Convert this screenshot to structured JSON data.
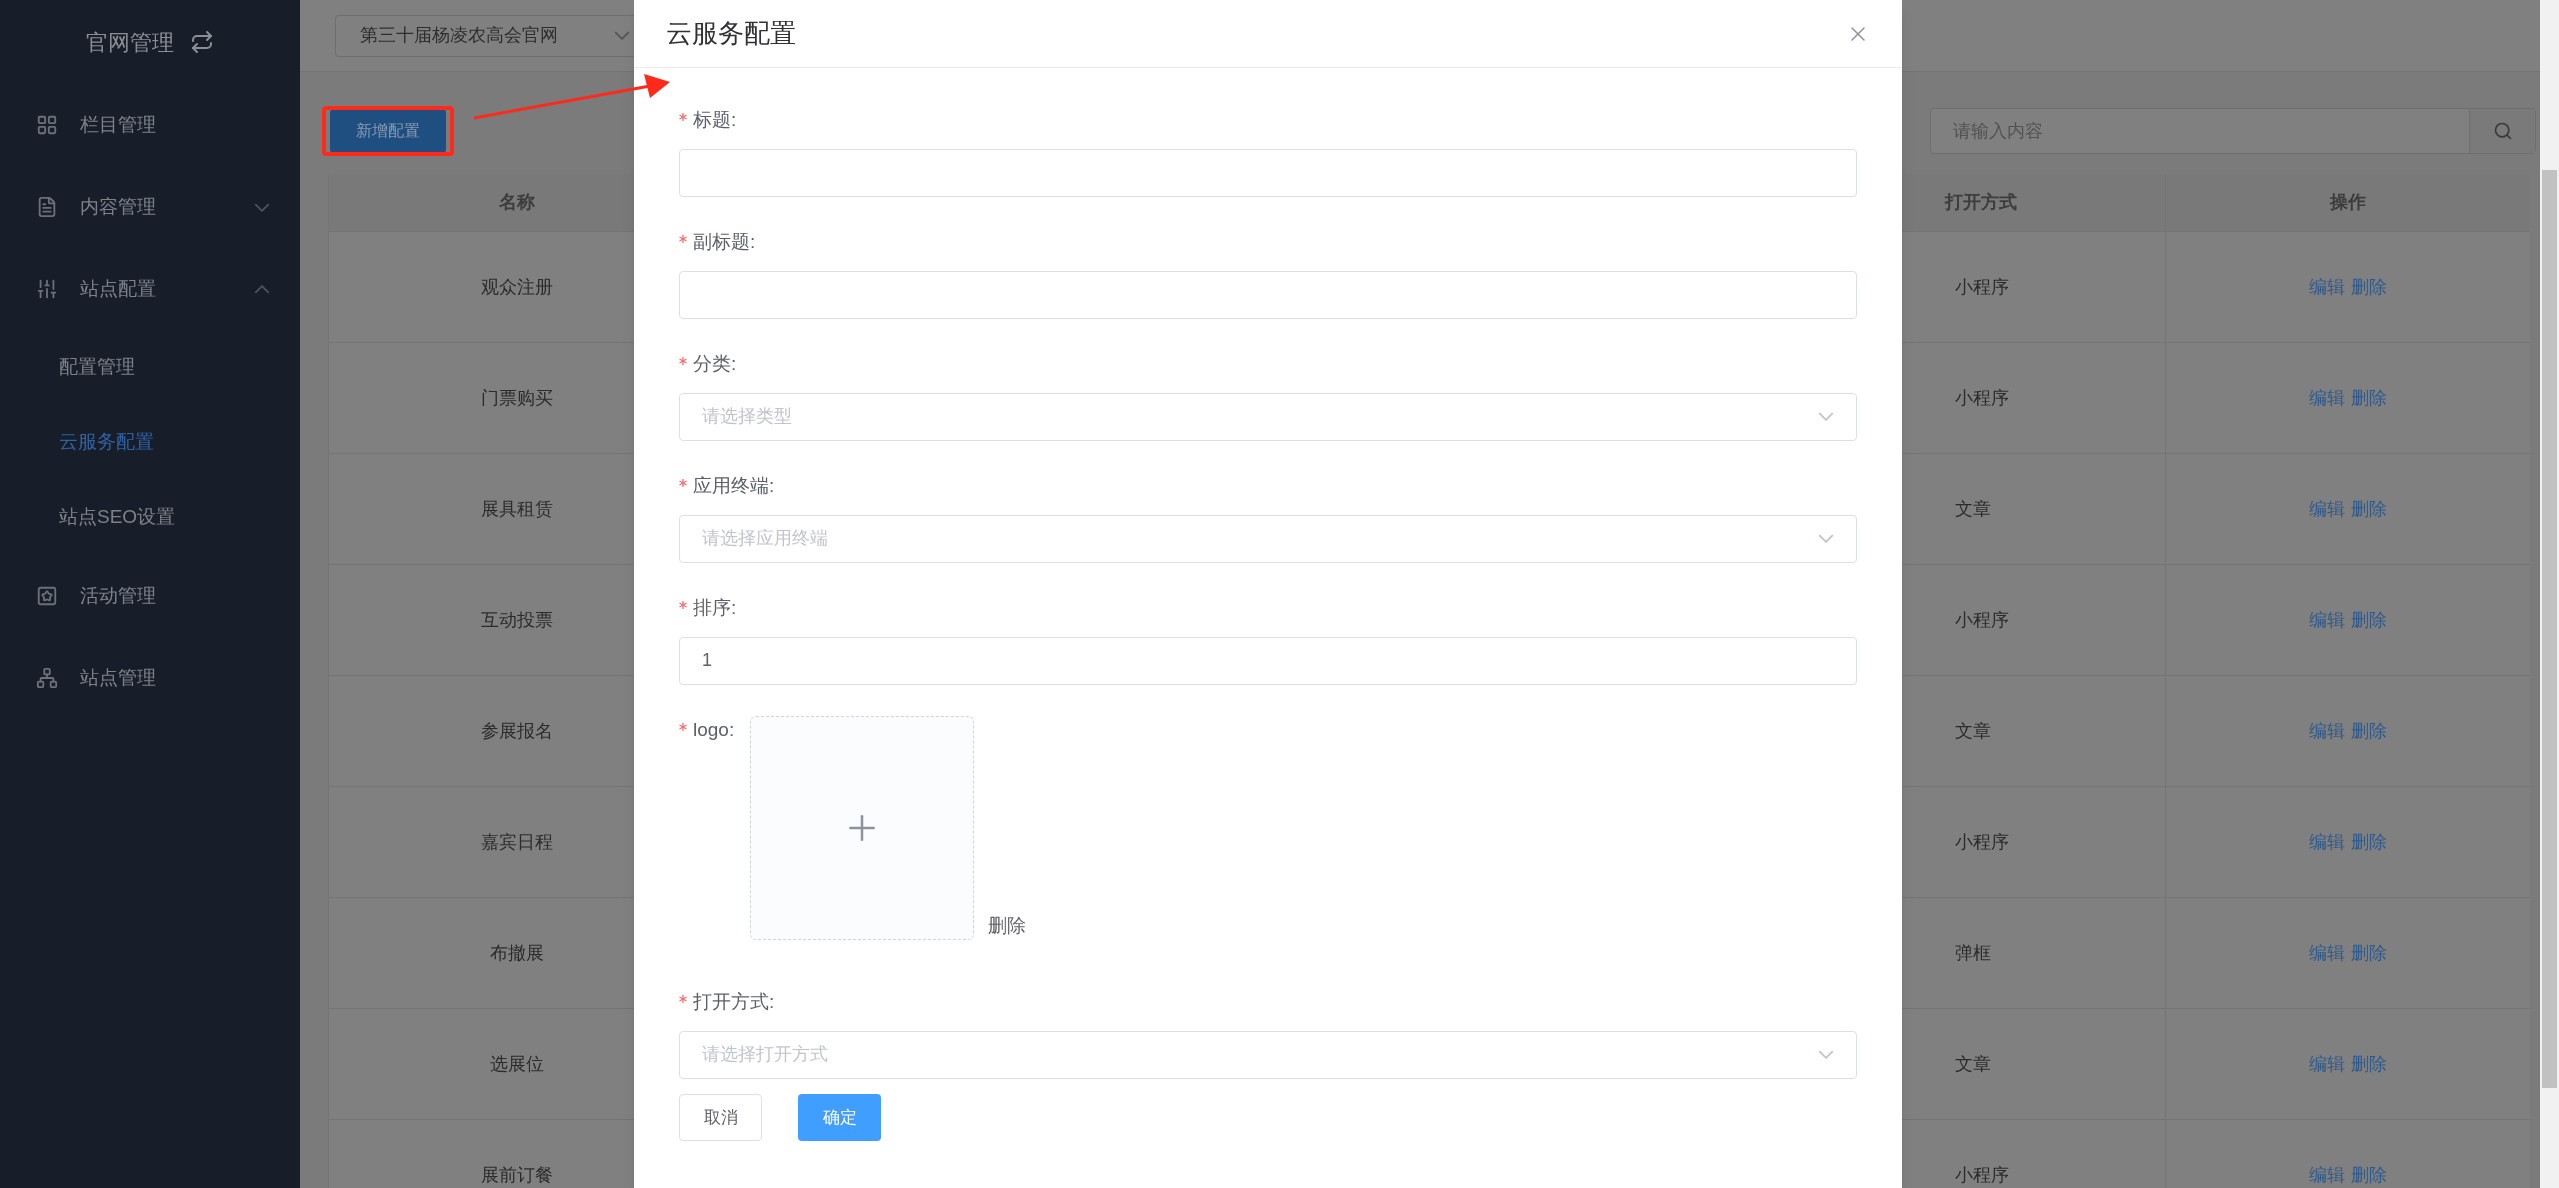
{
  "sidebar": {
    "title": "官网管理",
    "items": [
      {
        "label": "栏目管理"
      },
      {
        "label": "内容管理",
        "expanded": false
      },
      {
        "label": "站点配置",
        "expanded": true,
        "children": [
          {
            "label": "配置管理",
            "selected": false
          },
          {
            "label": "云服务配置",
            "selected": true
          },
          {
            "label": "站点SEO设置",
            "selected": false
          }
        ]
      },
      {
        "label": "活动管理"
      },
      {
        "label": "站点管理"
      }
    ]
  },
  "toolbar": {
    "site_select": "第三十届杨凌农高会官网",
    "add_button": "新增配置",
    "search": {
      "placeholder": "请输入内容"
    }
  },
  "table": {
    "columns": [
      "名称",
      "打开方式",
      "操作"
    ],
    "rows": [
      {
        "name": "观众注册",
        "open_mode": "小程序",
        "actions": [
          "编辑",
          "删除"
        ]
      },
      {
        "name": "门票购买",
        "open_mode": "小程序",
        "actions": [
          "编辑",
          "删除"
        ]
      },
      {
        "name": "展具租赁",
        "open_mode": "文章",
        "actions": [
          "编辑",
          "删除"
        ]
      },
      {
        "name": "互动投票",
        "open_mode": "小程序",
        "actions": [
          "编辑",
          "删除"
        ]
      },
      {
        "name": "参展报名",
        "open_mode": "文章",
        "actions": [
          "编辑",
          "删除"
        ]
      },
      {
        "name": "嘉宾日程",
        "open_mode": "小程序",
        "actions": [
          "编辑",
          "删除"
        ]
      },
      {
        "name": "布撤展",
        "open_mode": "弹框",
        "actions": [
          "编辑",
          "删除"
        ]
      },
      {
        "name": "选展位",
        "open_mode": "文章",
        "actions": [
          "编辑",
          "删除"
        ]
      },
      {
        "name": "展前订餐",
        "open_mode": "小程序",
        "actions": [
          "编辑",
          "删除"
        ]
      }
    ]
  },
  "dialog": {
    "title": "云服务配置",
    "fields": [
      {
        "kind": "text",
        "label": "标题:",
        "required": true
      },
      {
        "kind": "text",
        "label": "副标题:",
        "required": true
      },
      {
        "kind": "select",
        "label": "分类:",
        "required": true,
        "placeholder": "请选择类型"
      },
      {
        "kind": "select",
        "label": "应用终端:",
        "required": true,
        "placeholder": "请选择应用终端"
      },
      {
        "kind": "text",
        "label": "排序:",
        "required": true,
        "value": "1"
      },
      {
        "kind": "upload",
        "label": "logo:",
        "required": true,
        "action": "删除"
      },
      {
        "kind": "select",
        "label": "打开方式:",
        "required": true,
        "placeholder": "请选择打开方式"
      }
    ],
    "buttons": [
      {
        "kind": "cancel",
        "label": "取消"
      },
      {
        "kind": "confirm",
        "label": "确定"
      }
    ]
  }
}
